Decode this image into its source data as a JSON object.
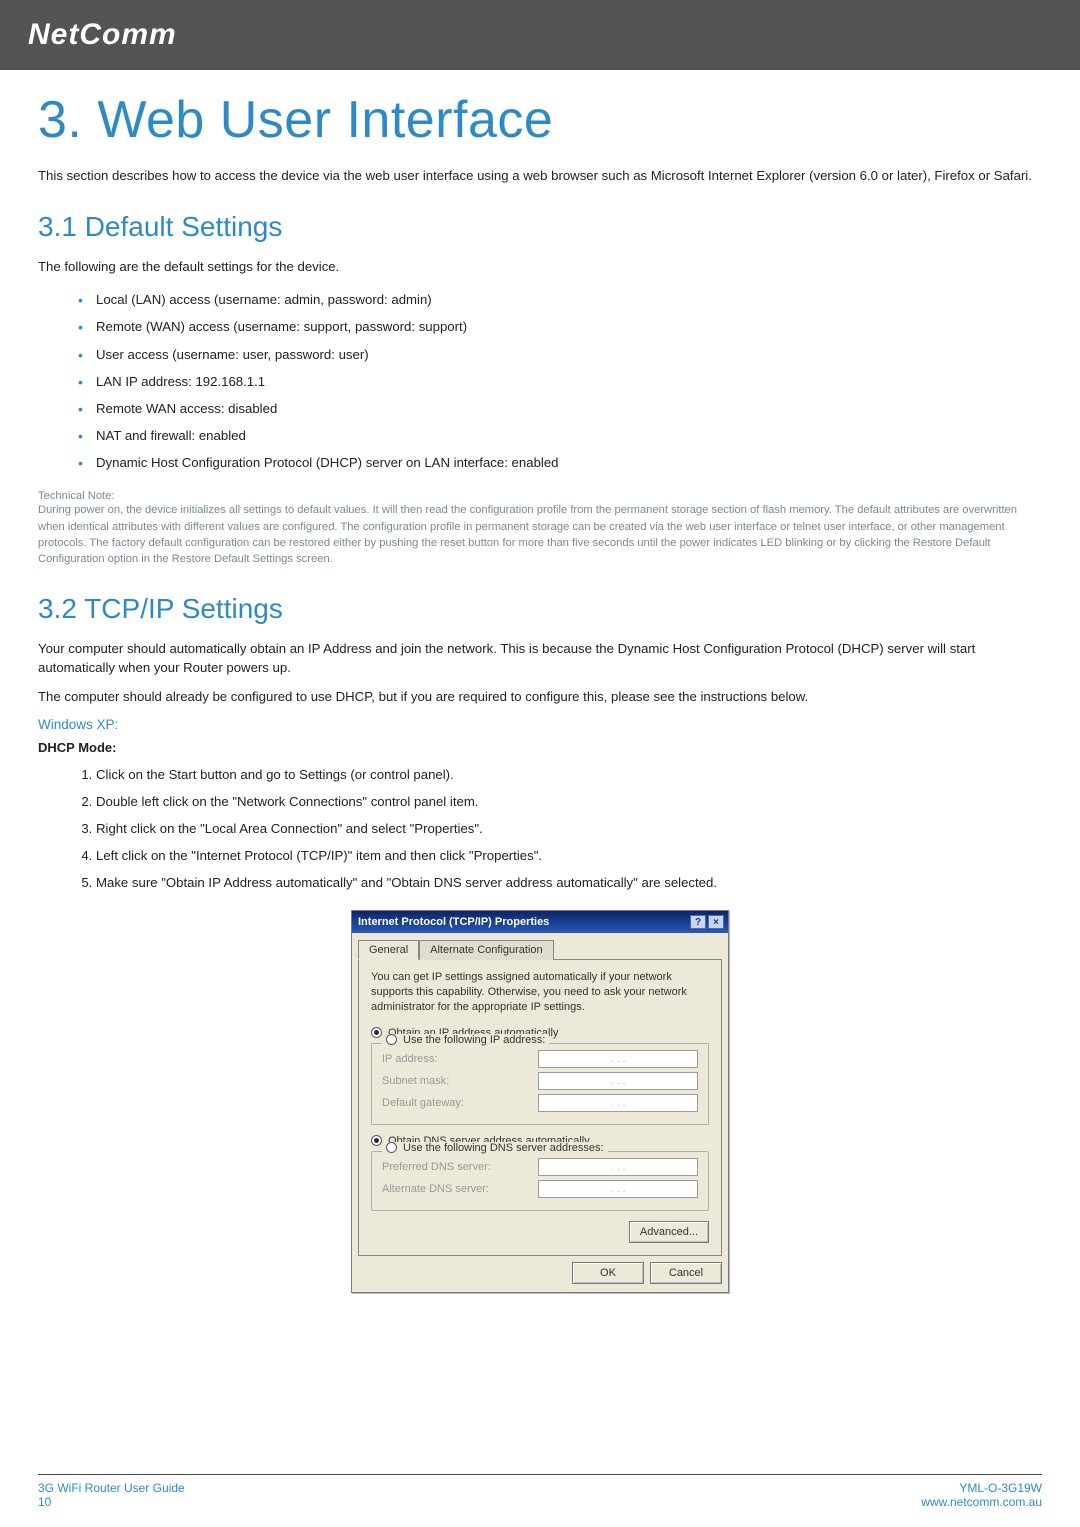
{
  "brand": {
    "logo": "NetComm"
  },
  "title": "3. Web User Interface",
  "intro": "This section describes how to access the device via the web user interface using a web browser such as Microsoft Internet Explorer (version 6.0 or later), Firefox or Safari.",
  "section31": {
    "heading": "3.1 Default Settings",
    "lead": "The following are the default settings for the device.",
    "bullets": [
      "Local (LAN) access (username: admin, password: admin)",
      "Remote (WAN) access (username: support, password: support)",
      "User access (username: user, password: user)",
      "LAN IP address: 192.168.1.1",
      "Remote WAN access: disabled",
      "NAT and firewall: enabled",
      "Dynamic Host Configuration Protocol (DHCP) server on LAN interface: enabled"
    ],
    "technote_head": "Technical Note:",
    "technote_body": "During power on, the device initializes all settings to default values. It will then read the configuration profile from the permanent storage section of flash memory. The default attributes are overwritten when identical attributes with different values are configured. The configuration profile in permanent storage can be created via the web user interface or telnet user interface, or other management protocols. The factory default configuration can be restored either by pushing the reset button for more than five seconds until the power indicates LED blinking or by clicking the Restore Default Configuration option in the Restore Default Settings screen."
  },
  "section32": {
    "heading": "3.2 TCP/IP Settings",
    "p1": "Your computer should automatically obtain an IP Address and join the network. This is because the Dynamic Host Configuration Protocol (DHCP) server will start automatically when your Router powers up.",
    "p2": "The computer should already be configured to use DHCP, but if you are required to configure this, please see the instructions below.",
    "os": "Windows XP:",
    "mode": "DHCP Mode:",
    "steps": [
      "Click on the Start button and go to Settings (or control panel).",
      "Double left click on the \"Network Connections\" control panel item.",
      "Right click on the \"Local Area Connection\" and select \"Properties\".",
      "Left click on the \"Internet Protocol (TCP/IP)\" item and then click \"Properties\".",
      "Make sure \"Obtain IP Address automatically\" and \"Obtain DNS server address automatically\" are selected."
    ]
  },
  "dialog": {
    "title": "Internet Protocol (TCP/IP) Properties",
    "help_glyph": "?",
    "close_glyph": "×",
    "tab_general": "General",
    "tab_alt": "Alternate Configuration",
    "desc": "You can get IP settings assigned automatically if your network supports this capability. Otherwise, you need to ask your network administrator for the appropriate IP settings.",
    "r_ip_auto": "Obtain an IP address automatically",
    "r_ip_manual": "Use the following IP address:",
    "f_ip": "IP address:",
    "f_mask": "Subnet mask:",
    "f_gw": "Default gateway:",
    "r_dns_auto": "Obtain DNS server address automatically",
    "r_dns_manual": "Use the following DNS server addresses:",
    "f_pdns": "Preferred DNS server:",
    "f_adns": "Alternate DNS server:",
    "btn_adv": "Advanced...",
    "btn_ok": "OK",
    "btn_cancel": "Cancel",
    "ip_placeholder": ".   .   ."
  },
  "footer": {
    "left1": "3G WiFi Router User Guide",
    "left2": "10",
    "right1": "YML-O-3G19W",
    "right2": "www.netcomm.com.au"
  }
}
